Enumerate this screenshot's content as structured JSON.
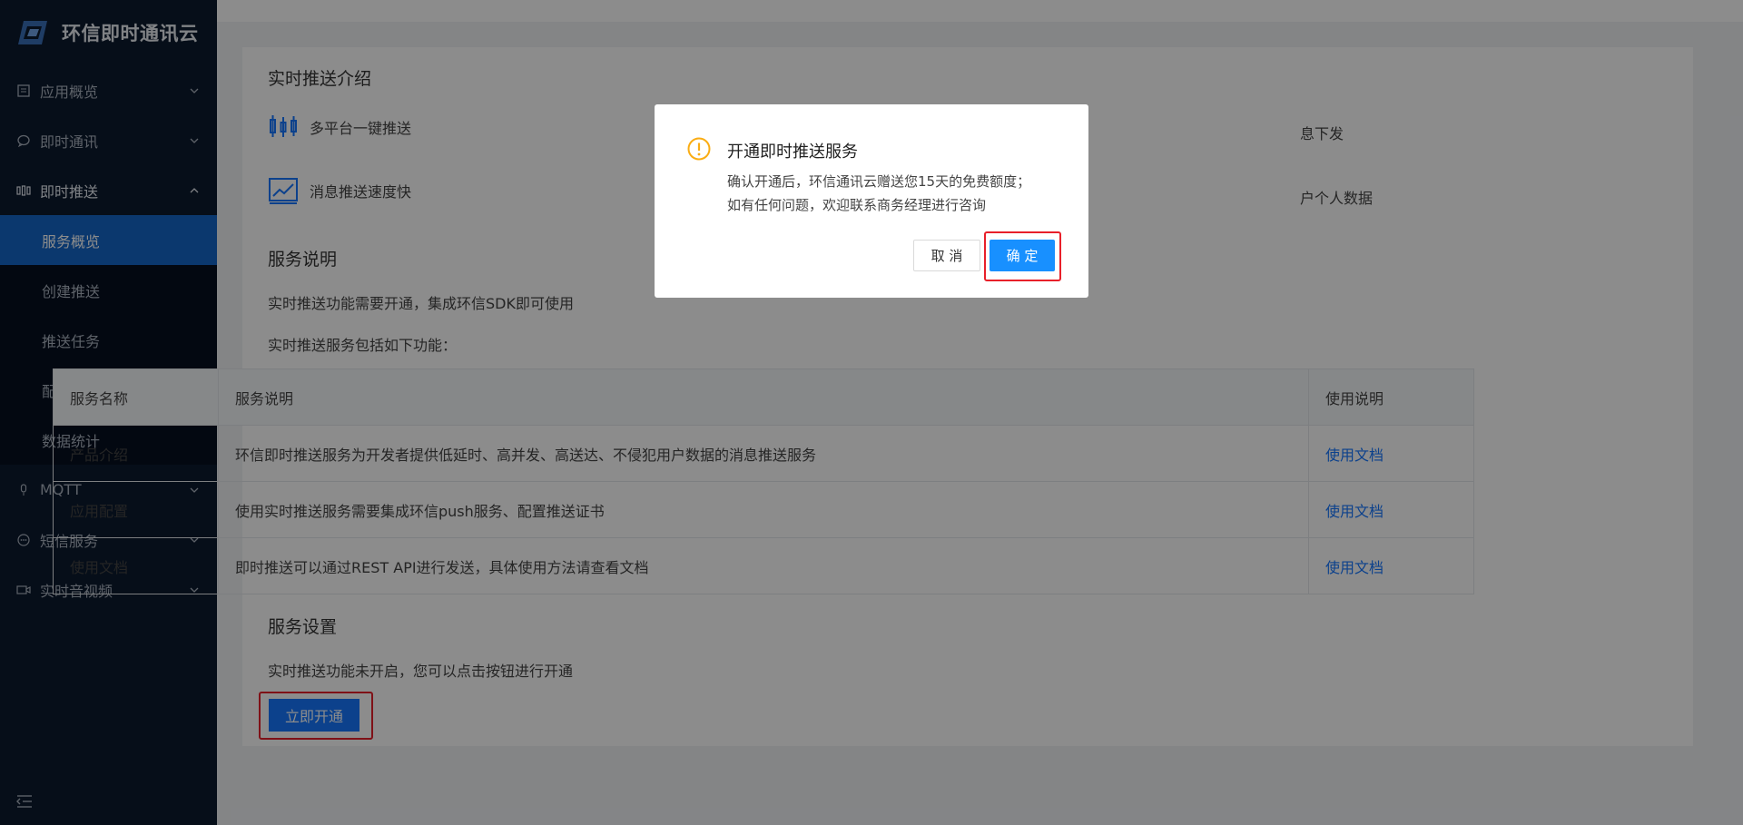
{
  "brand": {
    "name": "环信即时通讯云"
  },
  "sidebar": {
    "items": [
      {
        "label": "应用概览",
        "icon": "doc-icon"
      },
      {
        "label": "即时通讯",
        "icon": "chat-icon"
      },
      {
        "label": "即时推送",
        "icon": "push-icon"
      },
      {
        "label": "MQTT",
        "icon": "mic-icon"
      },
      {
        "label": "短信服务",
        "icon": "sms-icon"
      },
      {
        "label": "实时音视频",
        "icon": "video-icon"
      }
    ],
    "push_children": [
      "服务概览",
      "创建推送",
      "推送任务",
      "配置证书",
      "数据统计"
    ],
    "active": "服务概览"
  },
  "intro": {
    "title": "实时推送介绍",
    "features": [
      "多平台一键推送",
      "消息推送速度快",
      "息下发",
      "户个人数据"
    ]
  },
  "service_desc": {
    "title": "服务说明",
    "line1": "实时推送功能需要开通，集成环信SDK即可使用",
    "line2": "实时推送服务包括如下功能：",
    "table": {
      "headers": [
        "服务名称",
        "服务说明",
        "使用说明"
      ],
      "rows": [
        {
          "name": "产品介绍",
          "desc": "环信即时推送服务为开发者提供低延时、高并发、高送达、不侵犯用户数据的消息推送服务",
          "link": "使用文档"
        },
        {
          "name": "应用配置",
          "desc": "使用实时推送服务需要集成环信push服务、配置推送证书",
          "link": "使用文档"
        },
        {
          "name": "使用文档",
          "desc": "即时推送可以通过REST API进行发送，具体使用方法请查看文档",
          "link": "使用文档"
        }
      ]
    }
  },
  "service_settings": {
    "title": "服务设置",
    "text": "实时推送功能未开启，您可以点击按钮进行开通",
    "button": "立即开通"
  },
  "dialog": {
    "title": "开通即时推送服务",
    "line1": "确认开通后，环信通讯云赠送您15天的免费额度；",
    "line2": "如有任何问题，欢迎联系商务经理进行咨询",
    "cancel": "取 消",
    "ok": "确 定"
  },
  "colors": {
    "primary": "#1677ff",
    "sidebar": "#0c1a2e",
    "active": "#1467c8",
    "highlight": "#e8202a",
    "warning": "#faad14"
  }
}
